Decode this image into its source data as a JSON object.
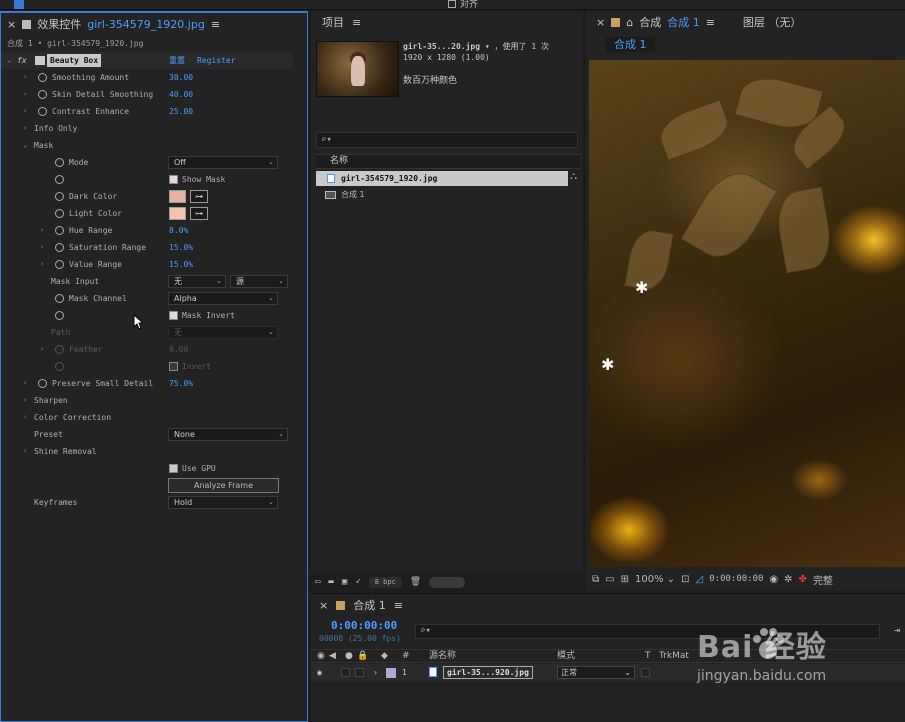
{
  "toolbar": {
    "align_label": "对齐"
  },
  "effects_panel": {
    "title": "效果控件",
    "file": "girl-354579_1920.jpg",
    "breadcrumb": "合成 1 • girl-354579_1920.jpg",
    "effect_name": "Beauty Box",
    "reset": "重置",
    "register": "Register",
    "rows": {
      "smoothing_amount": {
        "label": "Smoothing Amount",
        "value": "30.00"
      },
      "skin_detail": {
        "label": "Skin Detail Smoothing",
        "value": "40.00"
      },
      "contrast": {
        "label": "Contrast Enhance",
        "value": "25.00"
      },
      "info_only": {
        "label": "Info Only"
      },
      "mask": {
        "label": "Mask"
      },
      "mode": {
        "label": "Mode",
        "value": "Off"
      },
      "show_mask": {
        "label": "Show Mask"
      },
      "dark_color": {
        "label": "Dark Color",
        "color": "#e7b0a0"
      },
      "light_color": {
        "label": "Light Color",
        "color": "#f5c4ac"
      },
      "hue_range": {
        "label": "Hue Range",
        "value": "8.0%"
      },
      "saturation_range": {
        "label": "Saturation Range",
        "value": "15.0%"
      },
      "value_range": {
        "label": "Value Range",
        "value": "15.0%"
      },
      "mask_input": {
        "label": "Mask Input",
        "value": "无",
        "value2": "源"
      },
      "mask_channel": {
        "label": "Mask Channel",
        "value": "Alpha"
      },
      "mask_invert": {
        "label": "Mask Invert"
      },
      "path": {
        "label": "Path",
        "value": "无"
      },
      "feather": {
        "label": "Feather",
        "value": "0.00"
      },
      "invert": {
        "label": "Invert"
      },
      "preserve": {
        "label": "Preserve Small Detail",
        "value": "75.0%"
      },
      "sharpen": {
        "label": "Sharpen"
      },
      "color_correction": {
        "label": "Color Correction"
      },
      "preset": {
        "label": "Preset",
        "value": "None"
      },
      "shine_removal": {
        "label": "Shine Removal"
      },
      "use_gpu": {
        "label": "Use GPU"
      },
      "analyze": {
        "label": "Analyze Frame"
      },
      "keyframes": {
        "label": "Keyframes",
        "value": "Hold"
      }
    }
  },
  "project_panel": {
    "title": "项目",
    "file_name": "girl-35...20.jpg",
    "used": "，使用了 1 次",
    "dims": "1920 x 1280 (1.00)",
    "colors": "数百万种颜色",
    "search_icon": "⌕▾",
    "col_name": "名称",
    "items": [
      {
        "name": "girl-354579_1920.jpg"
      },
      {
        "name": "合成 1"
      }
    ],
    "bpc": "8 bpc"
  },
  "comp_panel": {
    "title": "合成",
    "comp_name": "合成 1",
    "layer_tab": "图层 （无）",
    "tab": "合成 1",
    "zoom": "100%",
    "timecode": "0:00:00:00",
    "quality": "完整"
  },
  "timeline": {
    "title": "合成 1",
    "timecode": "0:00:00:00",
    "fps": "00000 (25.00 fps)",
    "search_icon": "⌕▾",
    "col_hash": "#",
    "col_source": "源名称",
    "col_mode": "模式",
    "col_t": "T",
    "col_trkmat": "TrkMat",
    "layer": {
      "index": "1",
      "name": "girl-35...920.jpg",
      "mode": "正常"
    }
  },
  "watermark": {
    "brand": "Bai 经验",
    "url": "jingyan.baidu.com"
  }
}
